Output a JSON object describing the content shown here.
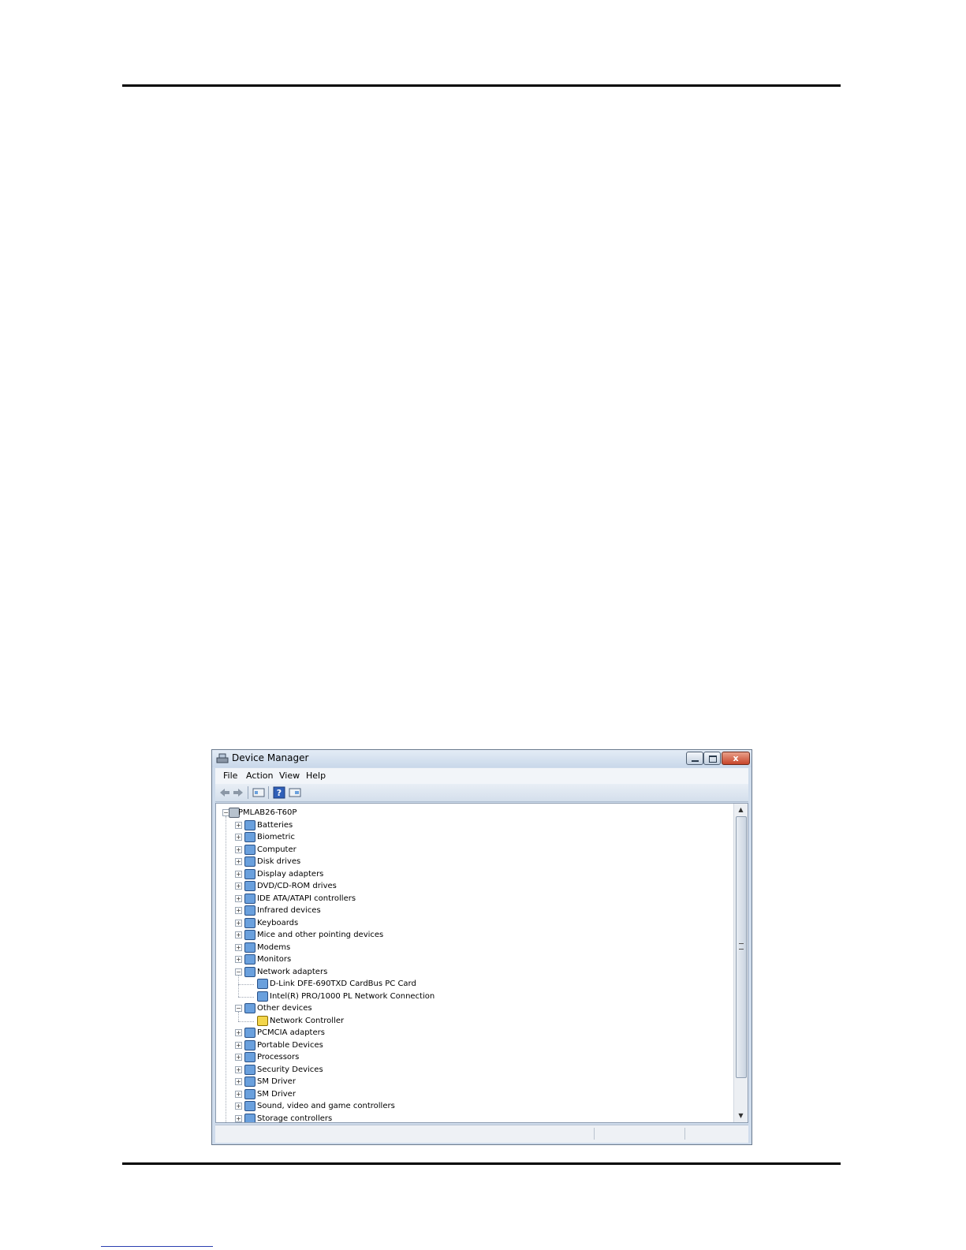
{
  "window": {
    "title": "Device Manager",
    "controls": {
      "close_glyph": "x"
    }
  },
  "menu": [
    "File",
    "Action",
    "View",
    "Help"
  ],
  "toolbar": {
    "icons": [
      "back-arrow-icon",
      "forward-arrow-icon",
      "properties-icon",
      "help-icon",
      "view-icon"
    ]
  },
  "tree": {
    "root": "PMLAB26-T60P",
    "items": [
      {
        "label": "Batteries",
        "expanded": false,
        "children": []
      },
      {
        "label": "Biometric",
        "expanded": false,
        "children": []
      },
      {
        "label": "Computer",
        "expanded": false,
        "children": []
      },
      {
        "label": "Disk drives",
        "expanded": false,
        "children": []
      },
      {
        "label": "Display adapters",
        "expanded": false,
        "children": []
      },
      {
        "label": "DVD/CD-ROM drives",
        "expanded": false,
        "children": []
      },
      {
        "label": "IDE ATA/ATAPI controllers",
        "expanded": false,
        "children": []
      },
      {
        "label": "Infrared devices",
        "expanded": false,
        "children": []
      },
      {
        "label": "Keyboards",
        "expanded": false,
        "children": []
      },
      {
        "label": "Mice and other pointing devices",
        "expanded": false,
        "children": []
      },
      {
        "label": "Modems",
        "expanded": false,
        "children": []
      },
      {
        "label": "Monitors",
        "expanded": false,
        "children": []
      },
      {
        "label": "Network adapters",
        "expanded": true,
        "children": [
          {
            "label": "D-Link DFE-690TXD CardBus PC Card",
            "status": ""
          },
          {
            "label": "Intel(R) PRO/1000 PL Network Connection",
            "status": ""
          }
        ]
      },
      {
        "label": "Other devices",
        "expanded": true,
        "children": [
          {
            "label": "Network Controller",
            "status": "warning"
          }
        ]
      },
      {
        "label": "PCMCIA adapters",
        "expanded": false,
        "children": []
      },
      {
        "label": "Portable Devices",
        "expanded": false,
        "children": []
      },
      {
        "label": "Processors",
        "expanded": false,
        "children": []
      },
      {
        "label": "Security Devices",
        "expanded": false,
        "children": []
      },
      {
        "label": "SM Driver",
        "expanded": false,
        "children": []
      },
      {
        "label": "SM Driver",
        "expanded": false,
        "children": []
      },
      {
        "label": "Sound, video and game controllers",
        "expanded": false,
        "children": []
      },
      {
        "label": "Storage controllers",
        "expanded": false,
        "children": []
      }
    ]
  },
  "scrollbar": {
    "up_glyph": "▲",
    "down_glyph": "▼"
  }
}
